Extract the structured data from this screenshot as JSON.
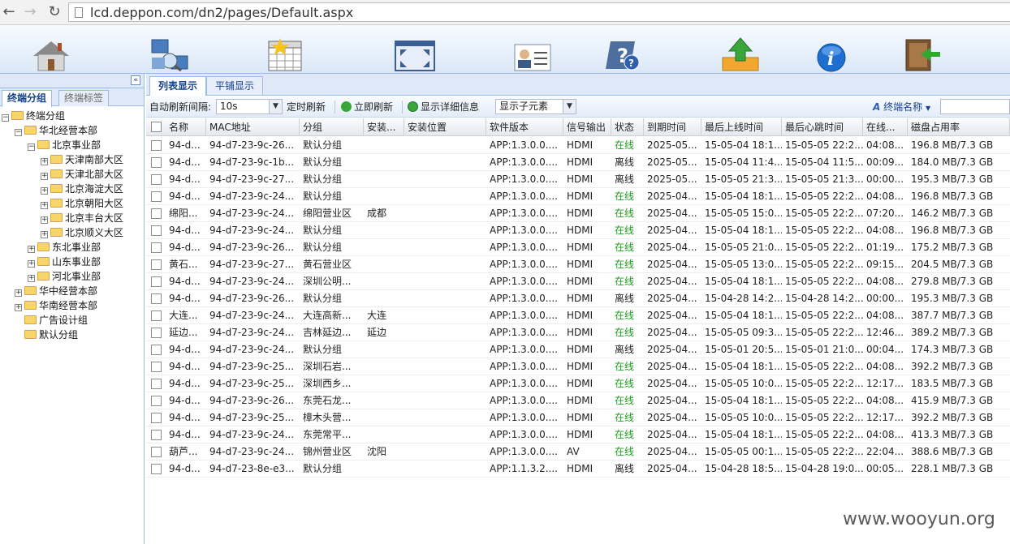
{
  "browser": {
    "url": "lcd.deppon.com/dn2/pages/Default.aspx"
  },
  "toolbar_icons": [
    "home-icon",
    "network-icon",
    "calendar-icon",
    "fullscreen-icon",
    "user-card-icon",
    "help-icon",
    "upload-icon",
    "info-icon",
    "exit-icon"
  ],
  "left_tabs": [
    "终端分组",
    "终端标签"
  ],
  "tree": [
    {
      "label": "终端分组",
      "level": 0,
      "toggle": "−"
    },
    {
      "label": "华北经营本部",
      "level": 1,
      "toggle": "−"
    },
    {
      "label": "北京事业部",
      "level": 2,
      "toggle": "−"
    },
    {
      "label": "天津南部大区",
      "level": 3,
      "toggle": "+"
    },
    {
      "label": "天津北部大区",
      "level": 3,
      "toggle": "+"
    },
    {
      "label": "北京海淀大区",
      "level": 3,
      "toggle": "+"
    },
    {
      "label": "北京朝阳大区",
      "level": 3,
      "toggle": "+"
    },
    {
      "label": "北京丰台大区",
      "level": 3,
      "toggle": "+"
    },
    {
      "label": "北京顺义大区",
      "level": 3,
      "toggle": "+"
    },
    {
      "label": "东北事业部",
      "level": 2,
      "toggle": "+"
    },
    {
      "label": "山东事业部",
      "level": 2,
      "toggle": "+"
    },
    {
      "label": "河北事业部",
      "level": 2,
      "toggle": "+"
    },
    {
      "label": "华中经营本部",
      "level": 1,
      "toggle": "+"
    },
    {
      "label": "华南经营本部",
      "level": 1,
      "toggle": "+"
    },
    {
      "label": "广告设计组",
      "level": 1,
      "toggle": ""
    },
    {
      "label": "默认分组",
      "level": 1,
      "toggle": ""
    }
  ],
  "right_tabs": [
    "列表显示",
    "平铺显示"
  ],
  "controls": {
    "refresh_interval_label": "自动刷新间隔:",
    "refresh_interval_value": "10s",
    "timed_refresh": "定时刷新",
    "refresh_now": "立即刷新",
    "show_details": "显示详细信息",
    "show_children": "显示子元素",
    "terminal_name": "终端名称"
  },
  "columns": [
    "名称",
    "MAC地址",
    "分组",
    "安装...",
    "安装位置",
    "软件版本",
    "信号输出",
    "状态",
    "到期时间",
    "最后上线时间",
    "最后心跳时间",
    "在线...",
    "磁盘占用率"
  ],
  "rows": [
    [
      "94-d...",
      "94-d7-23-9c-26...",
      "默认分组",
      "",
      "",
      "APP:1.3.0.0....",
      "HDMI",
      "在线",
      "2025-05...",
      "15-05-04 18:1...",
      "15-05-05 22:2...",
      "04:08...",
      "196.8 MB/7.3 GB"
    ],
    [
      "94-d...",
      "94-d7-23-9c-1b...",
      "默认分组",
      "",
      "",
      "APP:1.3.0.0....",
      "HDMI",
      "离线",
      "2025-05...",
      "15-05-04 11:4...",
      "15-05-04 11:5...",
      "00:09...",
      "184.0 MB/7.3 GB"
    ],
    [
      "94-d...",
      "94-d7-23-9c-27...",
      "默认分组",
      "",
      "",
      "APP:1.3.0.0....",
      "HDMI",
      "离线",
      "2025-05...",
      "15-05-05 21:3...",
      "15-05-05 21:3...",
      "00:00...",
      "195.3 MB/7.3 GB"
    ],
    [
      "94-d...",
      "94-d7-23-9c-24...",
      "默认分组",
      "",
      "",
      "APP:1.3.0.0....",
      "HDMI",
      "在线",
      "2025-04...",
      "15-05-04 18:1...",
      "15-05-05 22:2...",
      "04:08...",
      "196.8 MB/7.3 GB"
    ],
    [
      "绵阳...",
      "94-d7-23-9c-24...",
      "绵阳营业区",
      "成都",
      "",
      "APP:1.3.0.0....",
      "HDMI",
      "在线",
      "2025-04...",
      "15-05-05 15:0...",
      "15-05-05 22:2...",
      "07:20...",
      "146.2 MB/7.3 GB"
    ],
    [
      "94-d...",
      "94-d7-23-9c-24...",
      "默认分组",
      "",
      "",
      "APP:1.3.0.0....",
      "HDMI",
      "在线",
      "2025-04...",
      "15-05-04 18:1...",
      "15-05-05 22:2...",
      "04:08...",
      "196.8 MB/7.3 GB"
    ],
    [
      "94-d...",
      "94-d7-23-9c-26...",
      "默认分组",
      "",
      "",
      "APP:1.3.0.0....",
      "HDMI",
      "在线",
      "2025-04...",
      "15-05-05 21:0...",
      "15-05-05 22:2...",
      "01:19...",
      "175.2 MB/7.3 GB"
    ],
    [
      "黄石...",
      "94-d7-23-9c-27...",
      "黄石营业区",
      "",
      "",
      "APP:1.3.0.0....",
      "HDMI",
      "在线",
      "2025-04...",
      "15-05-05 13:0...",
      "15-05-05 22:2...",
      "09:15...",
      "204.5 MB/7.3 GB"
    ],
    [
      "94-d...",
      "94-d7-23-9c-24...",
      "深圳公明...",
      "",
      "",
      "APP:1.3.0.0....",
      "HDMI",
      "在线",
      "2025-04...",
      "15-05-04 18:1...",
      "15-05-05 22:2...",
      "04:08...",
      "279.8 MB/7.3 GB"
    ],
    [
      "94-d...",
      "94-d7-23-9c-26...",
      "默认分组",
      "",
      "",
      "APP:1.3.0.0....",
      "HDMI",
      "离线",
      "2025-04...",
      "15-04-28 14:2...",
      "15-04-28 14:2...",
      "00:00...",
      "195.3 MB/7.3 GB"
    ],
    [
      "大连...",
      "94-d7-23-9c-24...",
      "大连高新...",
      "大连",
      "",
      "APP:1.3.0.0....",
      "HDMI",
      "在线",
      "2025-04...",
      "15-05-04 18:1...",
      "15-05-05 22:2...",
      "04:08...",
      "387.7 MB/7.3 GB"
    ],
    [
      "延边...",
      "94-d7-23-9c-24...",
      "吉林延边...",
      "延边",
      "",
      "APP:1.3.0.0....",
      "HDMI",
      "在线",
      "2025-04...",
      "15-05-05 09:3...",
      "15-05-05 22:2...",
      "12:46...",
      "389.2 MB/7.3 GB"
    ],
    [
      "94-d...",
      "94-d7-23-9c-24...",
      "默认分组",
      "",
      "",
      "APP:1.3.0.0....",
      "HDMI",
      "离线",
      "2025-04...",
      "15-05-01 20:5...",
      "15-05-01 21:0...",
      "00:04...",
      "174.3 MB/7.3 GB"
    ],
    [
      "94-d...",
      "94-d7-23-9c-25...",
      "深圳石岩...",
      "",
      "",
      "APP:1.3.0.0....",
      "HDMI",
      "在线",
      "2025-04...",
      "15-05-04 18:1...",
      "15-05-05 22:2...",
      "04:08...",
      "392.2 MB/7.3 GB"
    ],
    [
      "94-d...",
      "94-d7-23-9c-25...",
      "深圳西乡...",
      "",
      "",
      "APP:1.3.0.0....",
      "HDMI",
      "在线",
      "2025-04...",
      "15-05-05 10:0...",
      "15-05-05 22:2...",
      "12:17...",
      "183.5 MB/7.3 GB"
    ],
    [
      "94-d...",
      "94-d7-23-9c-26...",
      "东莞石龙...",
      "",
      "",
      "APP:1.3.0.0....",
      "HDMI",
      "在线",
      "2025-04...",
      "15-05-04 18:1...",
      "15-05-05 22:2...",
      "04:08...",
      "415.9 MB/7.3 GB"
    ],
    [
      "94-d...",
      "94-d7-23-9c-25...",
      "樟木头营...",
      "",
      "",
      "APP:1.3.0.0....",
      "HDMI",
      "在线",
      "2025-04...",
      "15-05-05 10:0...",
      "15-05-05 22:2...",
      "12:17...",
      "392.2 MB/7.3 GB"
    ],
    [
      "94-d...",
      "94-d7-23-9c-24...",
      "东莞常平...",
      "",
      "",
      "APP:1.3.0.0....",
      "HDMI",
      "在线",
      "2025-04...",
      "15-05-04 18:1...",
      "15-05-05 22:2...",
      "04:08...",
      "413.3 MB/7.3 GB"
    ],
    [
      "葫芦...",
      "94-d7-23-9c-24...",
      "锦州营业区",
      "沈阳",
      "",
      "APP:1.3.0.0....",
      "AV",
      "在线",
      "2025-04...",
      "15-05-05 00:1...",
      "15-05-05 22:2...",
      "22:04...",
      "388.6 MB/7.3 GB"
    ],
    [
      "94-d...",
      "94-d7-23-8e-e3...",
      "默认分组",
      "",
      "",
      "APP:1.1.3.2....",
      "HDMI",
      "离线",
      "2025-04...",
      "15-04-28 18:5...",
      "15-04-28 19:0...",
      "00:05...",
      "228.1 MB/7.3 GB"
    ]
  ],
  "watermark": "www.wooyun.org"
}
